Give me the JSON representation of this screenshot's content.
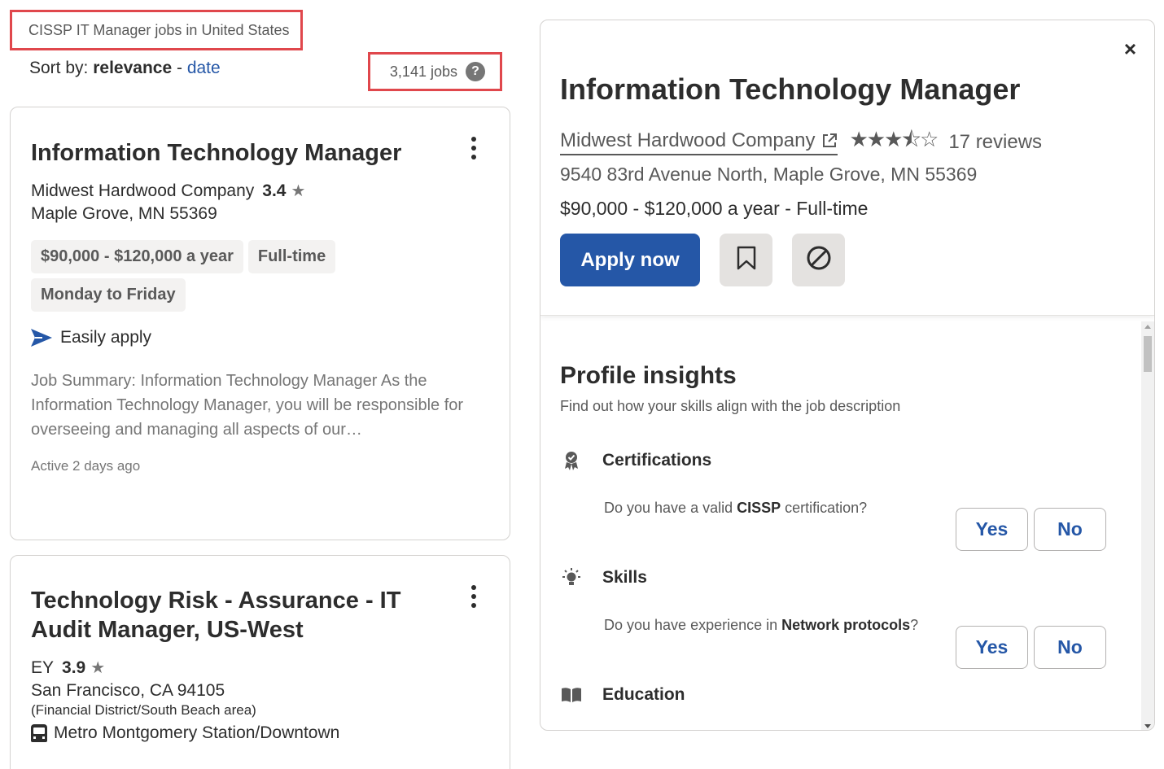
{
  "search": {
    "heading": "CISSP IT Manager jobs in United States",
    "sort_label": "Sort by:",
    "sort_active": "relevance",
    "sort_separator": "-",
    "sort_alt": "date",
    "job_count": "3,141 jobs",
    "help_glyph": "?"
  },
  "jobs": [
    {
      "title": "Information Technology Manager",
      "company": "Midwest Hardwood Company",
      "rating": "3.4",
      "location": "Maple Grove, MN 55369",
      "tags": [
        "$90,000 - $120,000 a year",
        "Full-time",
        "Monday to Friday"
      ],
      "easy_apply": "Easily apply",
      "snippet": "Job Summary: Information Technology Manager As the Information Technology Manager, you will be responsible for overseeing and managing all aspects of our…",
      "active": "Active 2 days ago"
    },
    {
      "title": "Technology Risk - Assurance - IT Audit Manager, US-West",
      "company": "EY",
      "rating": "3.9",
      "location": "San Francisco, CA 94105",
      "location_sub": "(Financial District/South Beach area)",
      "transit": "Metro Montgomery Station/Downtown"
    }
  ],
  "detail": {
    "close_glyph": "×",
    "title": "Information Technology Manager",
    "company": "Midwest Hardwood Company",
    "stars": "★★★⯪☆",
    "star_rating": 3.4,
    "reviews": "17 reviews",
    "address": "9540 83rd Avenue North, Maple Grove, MN 55369",
    "salary": "$90,000 - $120,000 a year  - Full-time",
    "apply_label": "Apply now",
    "insights": {
      "title": "Profile insights",
      "subtitle": "Find out how your skills align with the job description",
      "sections": [
        {
          "name": "Certifications",
          "question_pre": "Do you have a valid ",
          "question_bold": "CISSP",
          "question_post": " certification?",
          "yes": "Yes",
          "no": "No"
        },
        {
          "name": "Skills",
          "question_pre": "Do you have experience in ",
          "question_bold": "Network protocols",
          "question_post": "?",
          "yes": "Yes",
          "no": "No"
        },
        {
          "name": "Education"
        }
      ]
    }
  },
  "icons": {
    "help": "help-icon",
    "kebab": "more-options-icon",
    "star": "star-icon",
    "send": "paper-plane-icon",
    "bus": "bus-icon",
    "external": "external-link-icon",
    "bookmark": "bookmark-icon",
    "not_interested": "not-interested-icon",
    "certification": "award-badge-icon",
    "skills": "lightbulb-icon",
    "education": "book-icon"
  },
  "colors": {
    "accent": "#2557a7",
    "highlight_box": "#e0474c",
    "tag_bg": "#f3f2f1"
  }
}
